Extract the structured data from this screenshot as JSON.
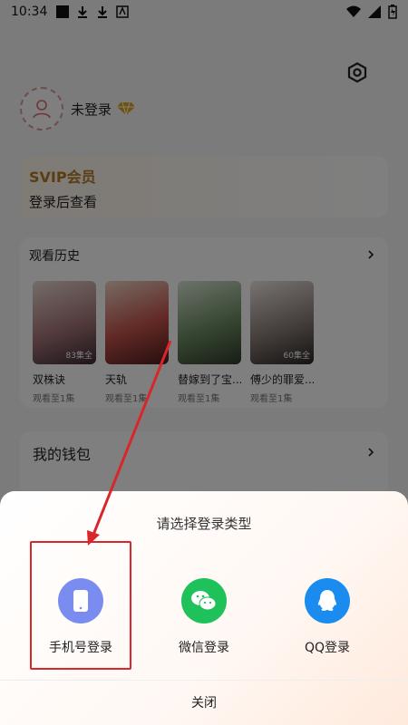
{
  "status_bar": {
    "time": "10:34"
  },
  "profile": {
    "login_status": "未登录"
  },
  "svip": {
    "title": "SVIP会员",
    "subtitle": "登录后查看"
  },
  "history": {
    "title": "观看历史",
    "items": [
      {
        "title": "双株诀",
        "progress": "观看至1集",
        "badge": "83集全"
      },
      {
        "title": "天轨",
        "progress": "观看至1集",
        "badge": ""
      },
      {
        "title": "替嫁到了宝...",
        "progress": "观看至1集",
        "badge": ""
      },
      {
        "title": "傅少的罪爱...",
        "progress": "观看至1集",
        "badge": "60集全"
      }
    ]
  },
  "wallet": {
    "title": "我的钱包"
  },
  "login_sheet": {
    "title": "请选择登录类型",
    "options": [
      {
        "label": "手机号登录",
        "icon": "phone-icon",
        "color": "#7b8cf0"
      },
      {
        "label": "微信登录",
        "icon": "wechat-icon",
        "color": "#1fc25a"
      },
      {
        "label": "QQ登录",
        "icon": "qq-icon",
        "color": "#1a8cf0"
      }
    ],
    "close_label": "关闭"
  }
}
